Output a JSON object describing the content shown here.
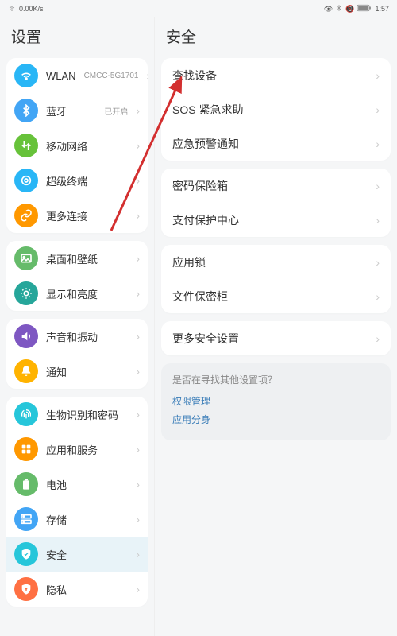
{
  "status": {
    "net_speed": "0.00K/s",
    "time": "1:57"
  },
  "left": {
    "title": "设置",
    "groups": [
      {
        "items": [
          {
            "id": "wlan",
            "label": "WLAN",
            "value": "CMCC-5G1701",
            "icon": "wifi-icon",
            "color": "#29b6f6"
          },
          {
            "id": "bluetooth",
            "label": "蓝牙",
            "value": "已开启",
            "icon": "bluetooth-icon",
            "color": "#42a5f5"
          },
          {
            "id": "mobile-network",
            "label": "移动网络",
            "icon": "swap-icon",
            "color": "#67c23a"
          },
          {
            "id": "super-device",
            "label": "超级终端",
            "icon": "superdevice-icon",
            "color": "#29b6f6"
          },
          {
            "id": "more-connections",
            "label": "更多连接",
            "icon": "link-icon",
            "color": "#ff9800"
          }
        ]
      },
      {
        "items": [
          {
            "id": "wallpaper",
            "label": "桌面和壁纸",
            "icon": "image-icon",
            "color": "#66bb6a"
          },
          {
            "id": "display",
            "label": "显示和亮度",
            "icon": "brightness-icon",
            "color": "#26a69a"
          }
        ]
      },
      {
        "items": [
          {
            "id": "sound",
            "label": "声音和振动",
            "icon": "volume-icon",
            "color": "#7e57c2"
          },
          {
            "id": "notification",
            "label": "通知",
            "icon": "bell-icon",
            "color": "#ffb300"
          }
        ]
      },
      {
        "items": [
          {
            "id": "biometric",
            "label": "生物识别和密码",
            "icon": "fingerprint-icon",
            "color": "#26c6da"
          },
          {
            "id": "apps",
            "label": "应用和服务",
            "icon": "apps-icon",
            "color": "#ff9800"
          },
          {
            "id": "battery",
            "label": "电池",
            "icon": "battery-icon",
            "color": "#66bb6a"
          },
          {
            "id": "storage",
            "label": "存储",
            "icon": "storage-icon",
            "color": "#42a5f5"
          },
          {
            "id": "security",
            "label": "安全",
            "icon": "shield-icon",
            "color": "#26c6da",
            "selected": true
          },
          {
            "id": "privacy",
            "label": "隐私",
            "icon": "privacy-icon",
            "color": "#ff7043"
          }
        ]
      }
    ]
  },
  "right": {
    "title": "安全",
    "groups": [
      {
        "items": [
          {
            "id": "find-device",
            "label": "查找设备"
          },
          {
            "id": "sos",
            "label": "SOS 紧急求助"
          },
          {
            "id": "emergency-alert",
            "label": "应急预警通知"
          }
        ]
      },
      {
        "items": [
          {
            "id": "password-vault",
            "label": "密码保险箱"
          },
          {
            "id": "payment-protection",
            "label": "支付保护中心"
          }
        ]
      },
      {
        "items": [
          {
            "id": "app-lock",
            "label": "应用锁"
          },
          {
            "id": "file-safe",
            "label": "文件保密柜"
          }
        ]
      },
      {
        "items": [
          {
            "id": "more-security",
            "label": "更多安全设置"
          }
        ]
      }
    ],
    "tip": {
      "title": "是否在寻找其他设置项？",
      "links": [
        "权限管理",
        "应用分身"
      ]
    }
  }
}
